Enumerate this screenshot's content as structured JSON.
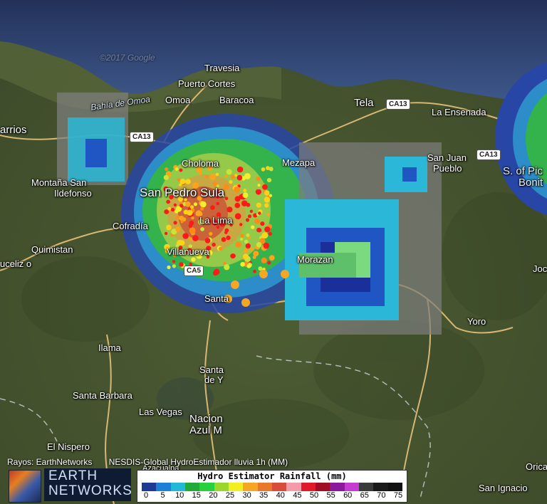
{
  "map": {
    "places": [
      "Travesia",
      "Puerto Cortes",
      "Omoa",
      "Baracoa",
      "Tela",
      "La Ensenada",
      "San Juan",
      "Pueblo",
      "arrios",
      "Montaña San",
      "Ildefonso",
      "San Pedro Sula",
      "Choloma",
      "Mezapa",
      "Cofradía",
      "La Lima",
      "Villanueva",
      "Quimistan",
      "uceliz o",
      "Morazan",
      "Santa",
      "Yoro",
      "Ilama",
      "Santa",
      "de Y",
      "Santa Barbara",
      "Las Vegas",
      "Nacion",
      "Azul M",
      "El Nispero",
      "Azacualpa",
      "S. of Pic",
      "Bonit",
      "Orica",
      "San Ignacio",
      "Jocó"
    ],
    "water_labels": [
      "Bahía de Omoa"
    ],
    "route_shields": [
      "CA13",
      "CA13",
      "CA13",
      "CA5"
    ],
    "watermark": "©2017 Google"
  },
  "credits": {
    "rayos": "Rayos: EarthNetworks",
    "nesdis": "NESDIS-Global HydroEstimador lluvia 1h (MM)"
  },
  "logo": {
    "line1": "EARTH",
    "line2": "NETWORKS"
  },
  "legend": {
    "title": "Hydro Estimator Rainfall (mm)",
    "ticks": [
      "0",
      "5",
      "10",
      "15",
      "20",
      "25",
      "30",
      "35",
      "40",
      "45",
      "50",
      "55",
      "60",
      "65",
      "70",
      "75"
    ],
    "colors": [
      "#1f3a93",
      "#1f7fd6",
      "#20b9d8",
      "#1faa3a",
      "#27d13d",
      "#9bd62a",
      "#f2ee22",
      "#f5a623",
      "#e8782b",
      "#d84c3b",
      "#f59aa8",
      "#e0192b",
      "#a00d24",
      "#8a1a9b",
      "#c43bd1",
      "#3a3a3a",
      "#1a1a1a",
      "#111111"
    ]
  }
}
